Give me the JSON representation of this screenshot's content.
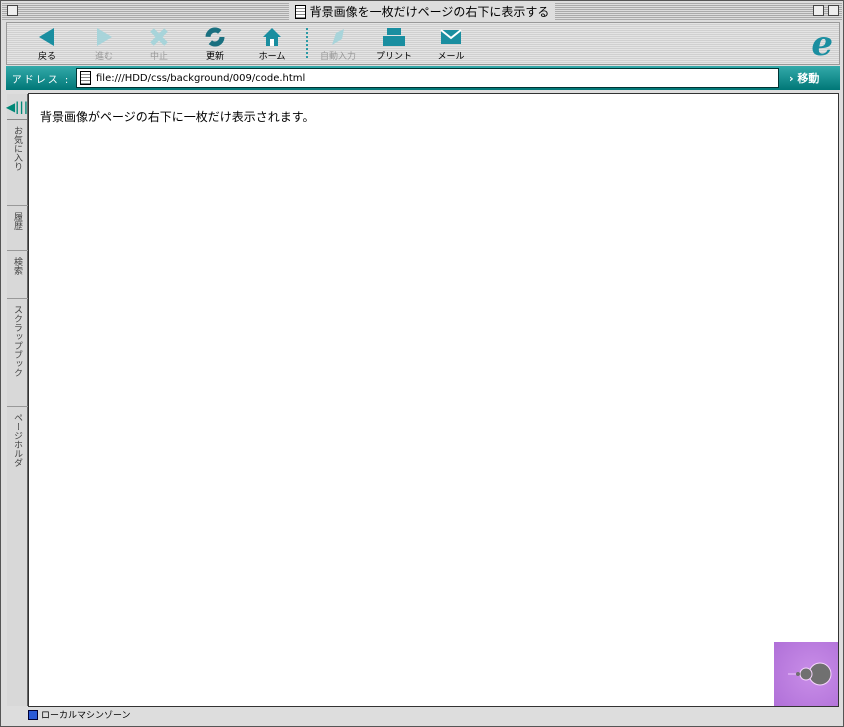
{
  "window": {
    "title": "背景画像を一枚だけページの右下に表示する"
  },
  "toolbar": {
    "items": [
      {
        "label": "戻る",
        "icon": "back-icon",
        "enabled": true
      },
      {
        "label": "進む",
        "icon": "forward-icon",
        "enabled": false
      },
      {
        "label": "中止",
        "icon": "stop-icon",
        "enabled": false
      },
      {
        "label": "更新",
        "icon": "refresh-icon",
        "enabled": true
      },
      {
        "label": "ホーム",
        "icon": "home-icon",
        "enabled": true
      },
      {
        "label": "自動入力",
        "icon": "autofill-icon",
        "enabled": false
      },
      {
        "label": "プリント",
        "icon": "print-icon",
        "enabled": true
      },
      {
        "label": "メール",
        "icon": "mail-icon",
        "enabled": true
      }
    ]
  },
  "address": {
    "label": "アドレス :",
    "url": "file:///HDD/css/background/009/code.html",
    "go": "移動"
  },
  "sidebar": {
    "tabs": [
      "お気に入り",
      "履歴",
      "検索",
      "スクラップブック",
      "ページホルダ"
    ]
  },
  "content": {
    "text": "背景画像がページの右下に一枚だけ表示されます。"
  },
  "status": {
    "zone": "ローカルマシンゾーン"
  },
  "colors": {
    "accent": "#1a8ea0"
  }
}
